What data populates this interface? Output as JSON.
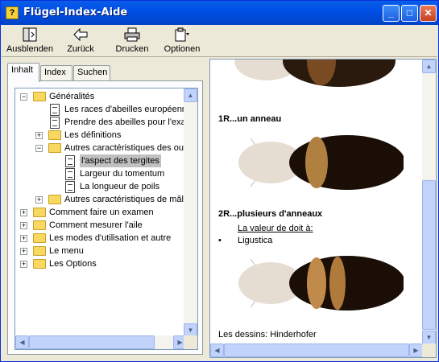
{
  "window": {
    "title": "Flügel-Index-Aide"
  },
  "toolbar": {
    "buttons": [
      {
        "label": "Ausblenden",
        "icon": "hide-icon"
      },
      {
        "label": "Zurück",
        "icon": "back-arrow-icon"
      },
      {
        "label": "Drucken",
        "icon": "printer-icon"
      },
      {
        "label": "Optionen",
        "icon": "options-icon"
      }
    ]
  },
  "tabs": [
    "Inhalt",
    "Index",
    "Suchen"
  ],
  "tree": [
    {
      "label": "Généralités",
      "level": 0,
      "type": "folder",
      "expanded": true
    },
    {
      "label": "Les races d'abeilles européennes",
      "level": 1,
      "type": "page"
    },
    {
      "label": "Prendre des abeilles pour l'examen",
      "level": 1,
      "type": "page"
    },
    {
      "label": "Les définitions",
      "level": 1,
      "type": "folder",
      "expanded": false
    },
    {
      "label": "Autres caractéristiques des ouvrières",
      "level": 1,
      "type": "folder",
      "expanded": true
    },
    {
      "label": "l'aspect des tergites",
      "level": 2,
      "type": "page",
      "selected": true
    },
    {
      "label": "Largeur du tomentum",
      "level": 2,
      "type": "page"
    },
    {
      "label": "La longueur de poils",
      "level": 2,
      "type": "page"
    },
    {
      "label": "Autres caractéristiques de mâles",
      "level": 1,
      "type": "folder",
      "expanded": false
    },
    {
      "label": "Comment faire un examen",
      "level": 0,
      "type": "folder",
      "expanded": false
    },
    {
      "label": "Comment mesurer l'aile",
      "level": 0,
      "type": "folder",
      "expanded": false
    },
    {
      "label": "Les modes d'utilisation  et autre",
      "level": 0,
      "type": "folder",
      "expanded": false
    },
    {
      "label": "Le menu",
      "level": 0,
      "type": "folder",
      "expanded": false
    },
    {
      "label": "Les Options",
      "level": 0,
      "type": "folder",
      "expanded": false
    }
  ],
  "content": {
    "heading1": "1R...un anneau",
    "heading2": "2R...plusieurs d'anneaux",
    "value_label": "La valeur de doit à:",
    "bullet": "Ligustica",
    "credit": "Les dessins:  Hinderhofer"
  },
  "colors": {
    "titlebar": "#0050e6",
    "selection": "#c0c0c0",
    "folder": "#f8d860"
  }
}
